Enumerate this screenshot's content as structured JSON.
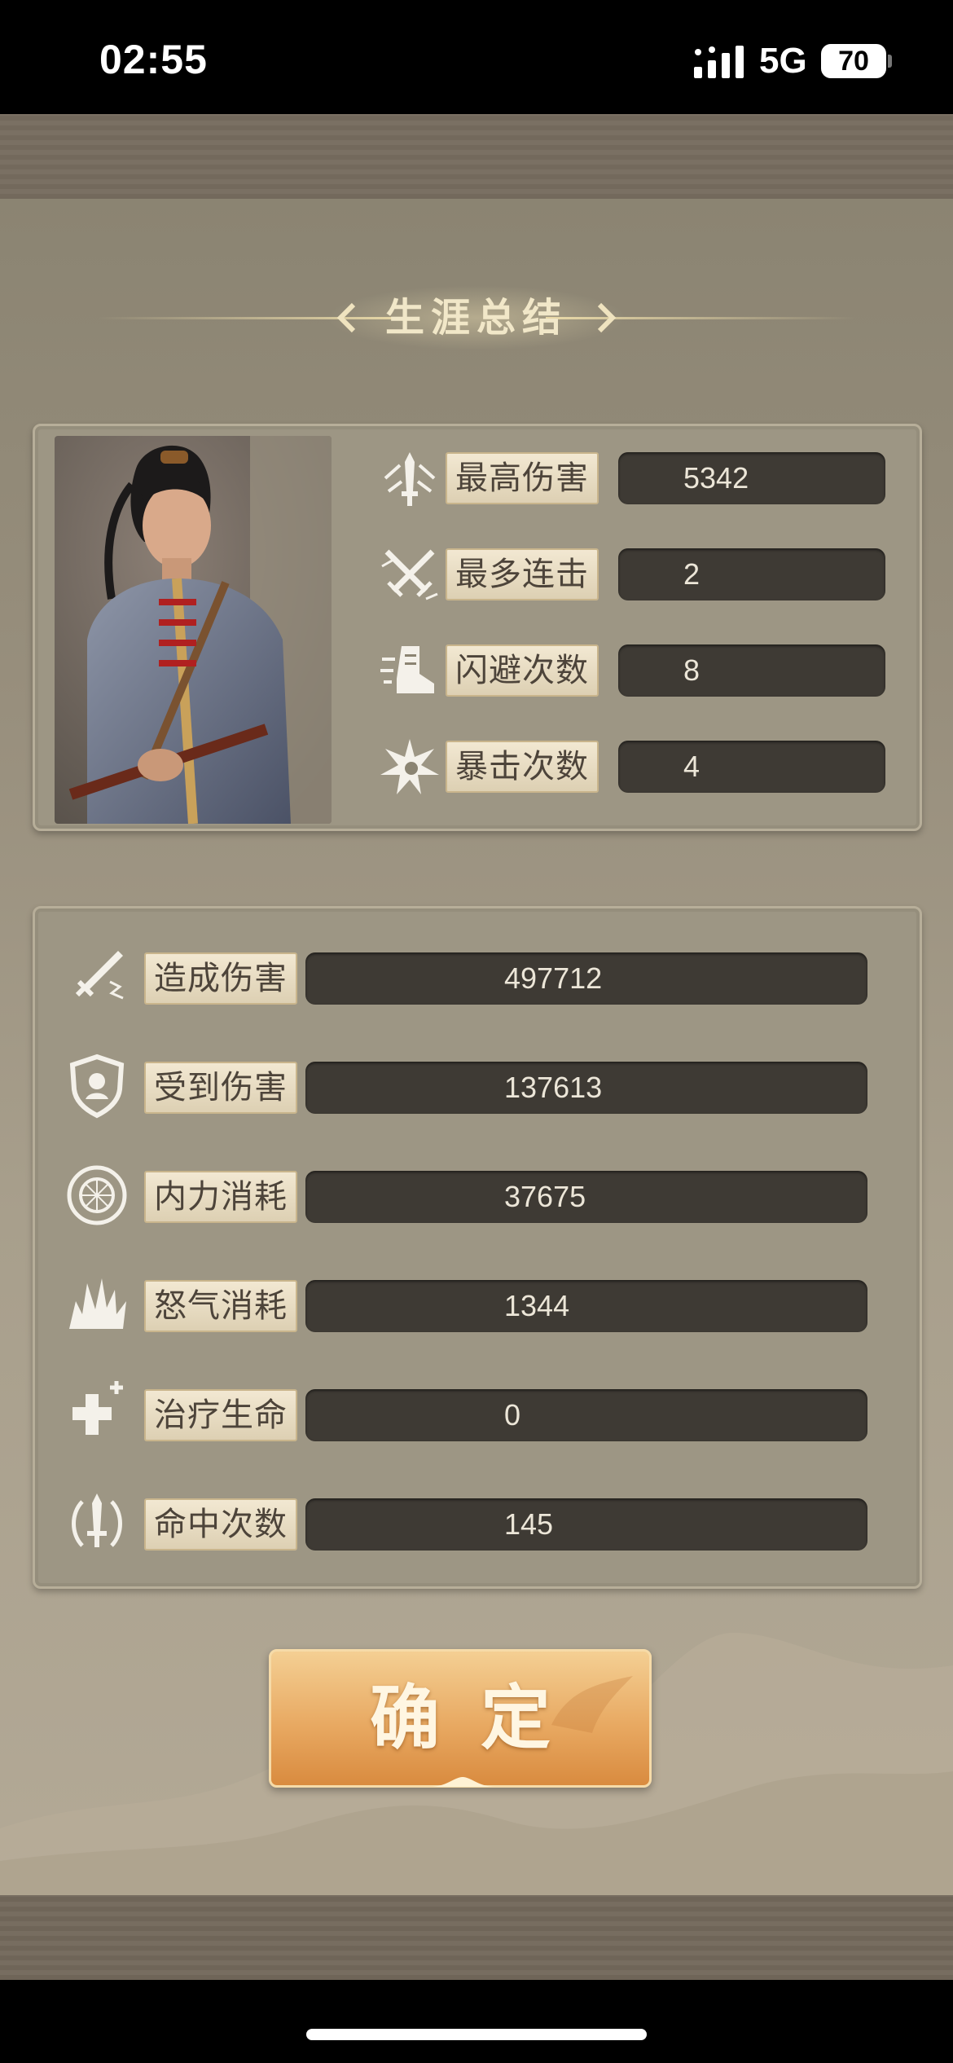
{
  "status_bar": {
    "time": "02:55",
    "network": "5G",
    "battery": "70"
  },
  "title": "生涯总结",
  "highlights": [
    {
      "icon": "sword-up-icon",
      "label": "最高伤害",
      "value": "5342"
    },
    {
      "icon": "crossed-swords-icon",
      "label": "最多连击",
      "value": "2"
    },
    {
      "icon": "boot-dodge-icon",
      "label": "闪避次数",
      "value": "8"
    },
    {
      "icon": "critical-burst-icon",
      "label": "暴击次数",
      "value": "4"
    }
  ],
  "totals": [
    {
      "icon": "slash-sword-icon",
      "label": "造成伤害",
      "value": "497712"
    },
    {
      "icon": "shield-icon",
      "label": "受到伤害",
      "value": "137613"
    },
    {
      "icon": "inner-power-icon",
      "label": "内力消耗",
      "value": "37675"
    },
    {
      "icon": "rage-burst-icon",
      "label": "怒气消耗",
      "value": "1344"
    },
    {
      "icon": "heal-plus-icon",
      "label": "治疗生命",
      "value": "0"
    },
    {
      "icon": "hit-sword-icon",
      "label": "命中次数",
      "value": "145"
    }
  ],
  "confirm_label": "确定",
  "colors": {
    "value_bg": "#3e3a34",
    "label_bg": "#ece2c8",
    "button_gold": "#e8a962"
  }
}
